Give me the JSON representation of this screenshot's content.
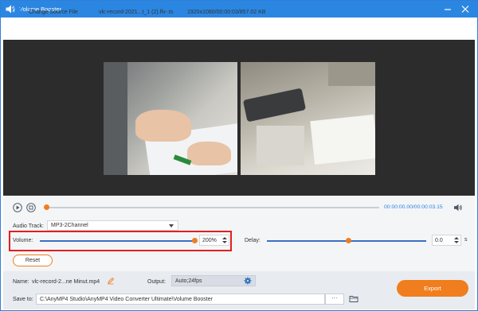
{
  "window": {
    "title": "Volume Booster",
    "minimize_icon": "minimize-icon",
    "close_icon": "close-icon",
    "accent_color": "#2b86e2"
  },
  "toolbar": {
    "change_source_label": "Change Source File",
    "file_name": "vlc-record-2021...t_1 (2).flv-.ts",
    "file_meta": "1920x1080/00:00:03/857.02 KB"
  },
  "player": {
    "timecode": "00:00:00.00/00:00:03.15",
    "progress": 0.0
  },
  "audio": {
    "track_label": "Audio Track:",
    "track_value": "MP3-2Channel",
    "volume_label": "Volume:",
    "volume_value": "200%",
    "volume_level": 1.0,
    "delay_label": "Delay:",
    "delay_value": "0.0",
    "delay_unit": "s",
    "delay_level": 0.5,
    "reset_label": "Reset"
  },
  "output": {
    "name_label": "Name:",
    "name_value": "vlc-record-2...ne Minut.mp4",
    "output_label": "Output:",
    "output_value": "Auto;24fps",
    "save_to_label": "Save to:",
    "save_to_value": "C:\\AnyMP4 Studio\\AnyMP4 Video Converter Ultimate\\Volume Booster",
    "browse_label": "···",
    "export_label": "Export",
    "export_color": "#f07d1e"
  }
}
